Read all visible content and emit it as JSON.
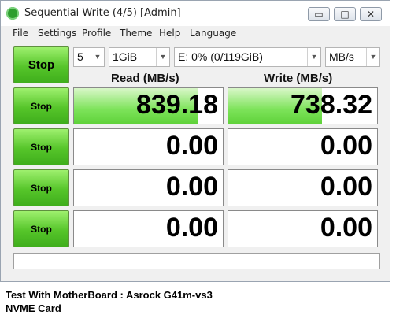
{
  "window": {
    "title": "Sequential Write (4/5) [Admin]"
  },
  "window_controls": {
    "minimize": "▭",
    "maximize": "□",
    "close": "✕"
  },
  "menu": [
    "File",
    "Settings",
    "Profile",
    "Theme",
    "Help",
    "Language"
  ],
  "main_button": "Stop",
  "settings": {
    "count": "5",
    "size": "1GiB",
    "drive": "E: 0% (0/119GiB)",
    "unit": "MB/s"
  },
  "headers": {
    "read": "Read (MB/s)",
    "write": "Write (MB/s)"
  },
  "rows": [
    {
      "button": "Stop",
      "read": "839.18",
      "write": "738.32",
      "read_fill": 0.83,
      "write_fill": 0.63
    },
    {
      "button": "Stop",
      "read": "0.00",
      "write": "0.00",
      "read_fill": 0,
      "write_fill": 0
    },
    {
      "button": "Stop",
      "read": "0.00",
      "write": "0.00",
      "read_fill": 0,
      "write_fill": 0
    },
    {
      "button": "Stop",
      "read": "0.00",
      "write": "0.00",
      "read_fill": 0,
      "write_fill": 0
    }
  ],
  "status": "",
  "caption": {
    "line1": "Test With MotherBoard : Asrock G41m-vs3",
    "line2": "NVME Card"
  },
  "colors": {
    "accent_green": "#56c52a",
    "bar_green": "#7de35a"
  },
  "icons": {
    "app": "cdm-app-icon",
    "dropdown": "chevron-down-icon"
  }
}
